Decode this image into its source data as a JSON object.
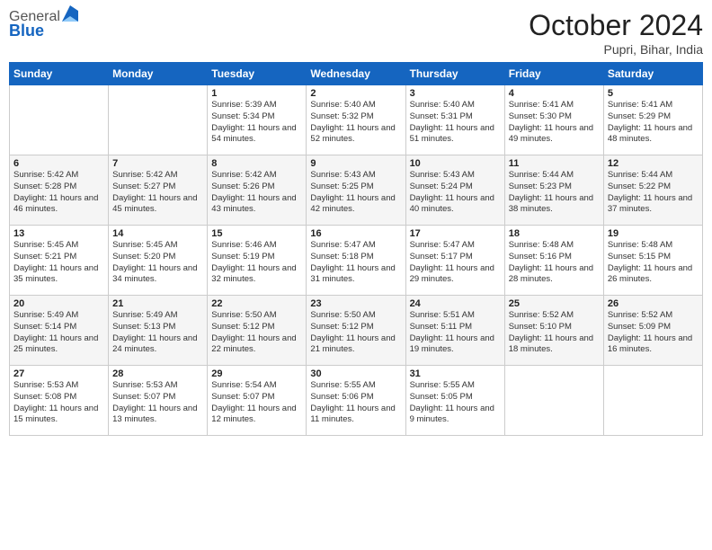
{
  "header": {
    "logo_general": "General",
    "logo_blue": "Blue",
    "month_title": "October 2024",
    "location": "Pupri, Bihar, India"
  },
  "weekdays": [
    "Sunday",
    "Monday",
    "Tuesday",
    "Wednesday",
    "Thursday",
    "Friday",
    "Saturday"
  ],
  "weeks": [
    [
      {
        "day": "",
        "sunrise": "",
        "sunset": "",
        "daylight": ""
      },
      {
        "day": "",
        "sunrise": "",
        "sunset": "",
        "daylight": ""
      },
      {
        "day": "1",
        "sunrise": "Sunrise: 5:39 AM",
        "sunset": "Sunset: 5:34 PM",
        "daylight": "Daylight: 11 hours and 54 minutes."
      },
      {
        "day": "2",
        "sunrise": "Sunrise: 5:40 AM",
        "sunset": "Sunset: 5:32 PM",
        "daylight": "Daylight: 11 hours and 52 minutes."
      },
      {
        "day": "3",
        "sunrise": "Sunrise: 5:40 AM",
        "sunset": "Sunset: 5:31 PM",
        "daylight": "Daylight: 11 hours and 51 minutes."
      },
      {
        "day": "4",
        "sunrise": "Sunrise: 5:41 AM",
        "sunset": "Sunset: 5:30 PM",
        "daylight": "Daylight: 11 hours and 49 minutes."
      },
      {
        "day": "5",
        "sunrise": "Sunrise: 5:41 AM",
        "sunset": "Sunset: 5:29 PM",
        "daylight": "Daylight: 11 hours and 48 minutes."
      }
    ],
    [
      {
        "day": "6",
        "sunrise": "Sunrise: 5:42 AM",
        "sunset": "Sunset: 5:28 PM",
        "daylight": "Daylight: 11 hours and 46 minutes."
      },
      {
        "day": "7",
        "sunrise": "Sunrise: 5:42 AM",
        "sunset": "Sunset: 5:27 PM",
        "daylight": "Daylight: 11 hours and 45 minutes."
      },
      {
        "day": "8",
        "sunrise": "Sunrise: 5:42 AM",
        "sunset": "Sunset: 5:26 PM",
        "daylight": "Daylight: 11 hours and 43 minutes."
      },
      {
        "day": "9",
        "sunrise": "Sunrise: 5:43 AM",
        "sunset": "Sunset: 5:25 PM",
        "daylight": "Daylight: 11 hours and 42 minutes."
      },
      {
        "day": "10",
        "sunrise": "Sunrise: 5:43 AM",
        "sunset": "Sunset: 5:24 PM",
        "daylight": "Daylight: 11 hours and 40 minutes."
      },
      {
        "day": "11",
        "sunrise": "Sunrise: 5:44 AM",
        "sunset": "Sunset: 5:23 PM",
        "daylight": "Daylight: 11 hours and 38 minutes."
      },
      {
        "day": "12",
        "sunrise": "Sunrise: 5:44 AM",
        "sunset": "Sunset: 5:22 PM",
        "daylight": "Daylight: 11 hours and 37 minutes."
      }
    ],
    [
      {
        "day": "13",
        "sunrise": "Sunrise: 5:45 AM",
        "sunset": "Sunset: 5:21 PM",
        "daylight": "Daylight: 11 hours and 35 minutes."
      },
      {
        "day": "14",
        "sunrise": "Sunrise: 5:45 AM",
        "sunset": "Sunset: 5:20 PM",
        "daylight": "Daylight: 11 hours and 34 minutes."
      },
      {
        "day": "15",
        "sunrise": "Sunrise: 5:46 AM",
        "sunset": "Sunset: 5:19 PM",
        "daylight": "Daylight: 11 hours and 32 minutes."
      },
      {
        "day": "16",
        "sunrise": "Sunrise: 5:47 AM",
        "sunset": "Sunset: 5:18 PM",
        "daylight": "Daylight: 11 hours and 31 minutes."
      },
      {
        "day": "17",
        "sunrise": "Sunrise: 5:47 AM",
        "sunset": "Sunset: 5:17 PM",
        "daylight": "Daylight: 11 hours and 29 minutes."
      },
      {
        "day": "18",
        "sunrise": "Sunrise: 5:48 AM",
        "sunset": "Sunset: 5:16 PM",
        "daylight": "Daylight: 11 hours and 28 minutes."
      },
      {
        "day": "19",
        "sunrise": "Sunrise: 5:48 AM",
        "sunset": "Sunset: 5:15 PM",
        "daylight": "Daylight: 11 hours and 26 minutes."
      }
    ],
    [
      {
        "day": "20",
        "sunrise": "Sunrise: 5:49 AM",
        "sunset": "Sunset: 5:14 PM",
        "daylight": "Daylight: 11 hours and 25 minutes."
      },
      {
        "day": "21",
        "sunrise": "Sunrise: 5:49 AM",
        "sunset": "Sunset: 5:13 PM",
        "daylight": "Daylight: 11 hours and 24 minutes."
      },
      {
        "day": "22",
        "sunrise": "Sunrise: 5:50 AM",
        "sunset": "Sunset: 5:12 PM",
        "daylight": "Daylight: 11 hours and 22 minutes."
      },
      {
        "day": "23",
        "sunrise": "Sunrise: 5:50 AM",
        "sunset": "Sunset: 5:12 PM",
        "daylight": "Daylight: 11 hours and 21 minutes."
      },
      {
        "day": "24",
        "sunrise": "Sunrise: 5:51 AM",
        "sunset": "Sunset: 5:11 PM",
        "daylight": "Daylight: 11 hours and 19 minutes."
      },
      {
        "day": "25",
        "sunrise": "Sunrise: 5:52 AM",
        "sunset": "Sunset: 5:10 PM",
        "daylight": "Daylight: 11 hours and 18 minutes."
      },
      {
        "day": "26",
        "sunrise": "Sunrise: 5:52 AM",
        "sunset": "Sunset: 5:09 PM",
        "daylight": "Daylight: 11 hours and 16 minutes."
      }
    ],
    [
      {
        "day": "27",
        "sunrise": "Sunrise: 5:53 AM",
        "sunset": "Sunset: 5:08 PM",
        "daylight": "Daylight: 11 hours and 15 minutes."
      },
      {
        "day": "28",
        "sunrise": "Sunrise: 5:53 AM",
        "sunset": "Sunset: 5:07 PM",
        "daylight": "Daylight: 11 hours and 13 minutes."
      },
      {
        "day": "29",
        "sunrise": "Sunrise: 5:54 AM",
        "sunset": "Sunset: 5:07 PM",
        "daylight": "Daylight: 11 hours and 12 minutes."
      },
      {
        "day": "30",
        "sunrise": "Sunrise: 5:55 AM",
        "sunset": "Sunset: 5:06 PM",
        "daylight": "Daylight: 11 hours and 11 minutes."
      },
      {
        "day": "31",
        "sunrise": "Sunrise: 5:55 AM",
        "sunset": "Sunset: 5:05 PM",
        "daylight": "Daylight: 11 hours and 9 minutes."
      },
      {
        "day": "",
        "sunrise": "",
        "sunset": "",
        "daylight": ""
      },
      {
        "day": "",
        "sunrise": "",
        "sunset": "",
        "daylight": ""
      }
    ]
  ]
}
